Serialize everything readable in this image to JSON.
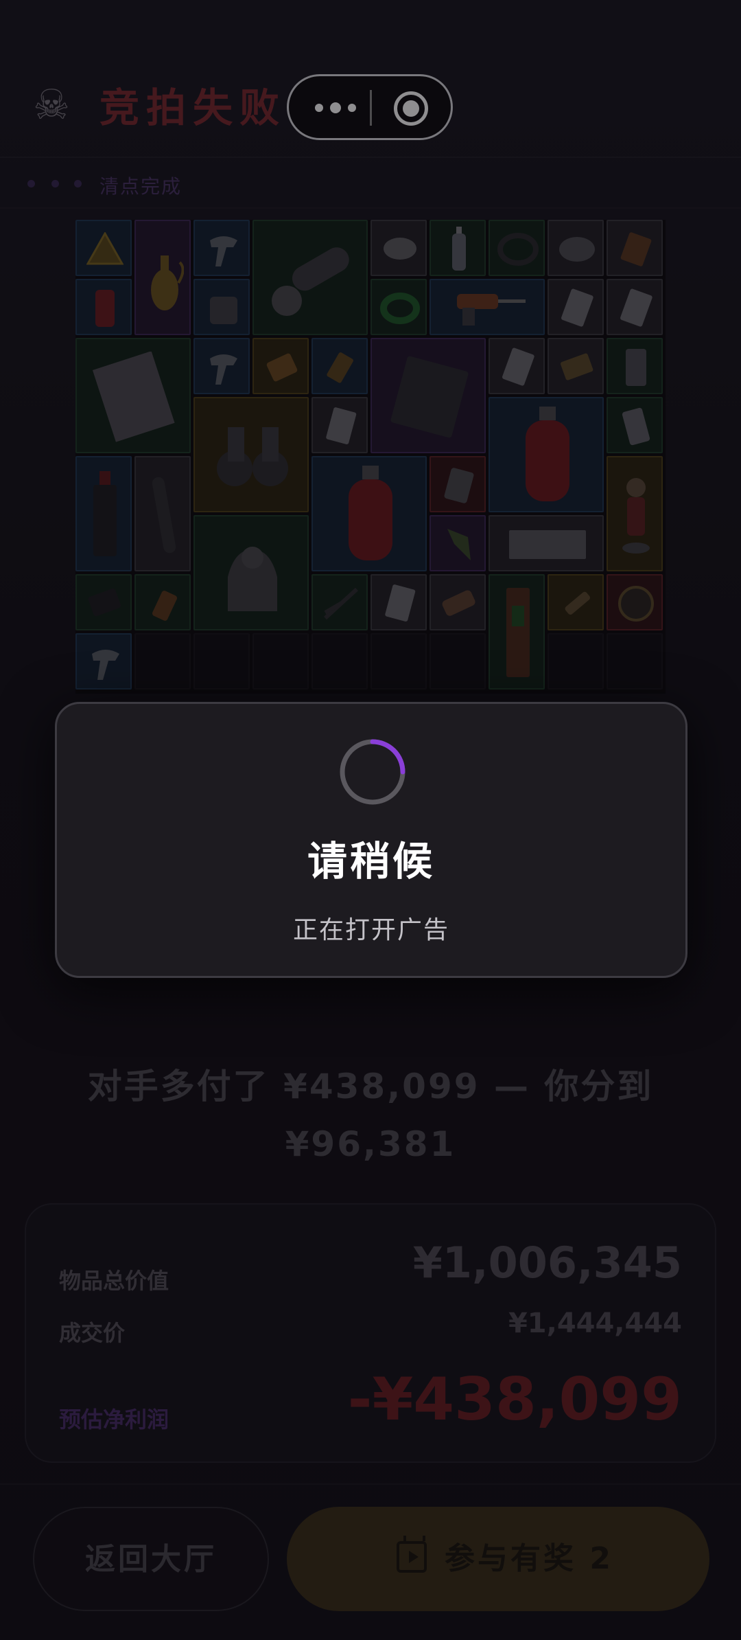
{
  "header": {
    "title": "竞拍失败",
    "skull_icon": "skull-icon",
    "menu_icon": "more-dots-icon",
    "close_icon": "target-circle-icon"
  },
  "status": {
    "text": "清点完成"
  },
  "inventory": {
    "items": [
      "warning-sign",
      "teapot",
      "thermometer-gun",
      "angle-grinder",
      "mouse",
      "water-bottle",
      "cable-coil",
      "tape-roll",
      "matchbox",
      "soda-can",
      "power-adapter",
      "green-cable",
      "power-drill",
      "playing-card",
      "playing-card",
      "magazine",
      "thermometer-gun",
      "battery-pack",
      "snack-bar",
      "motherboard",
      "playing-card",
      "playing-card",
      "cpu-cooler",
      "binoculars",
      "id-card",
      "gas-cylinder",
      "battery",
      "bottle",
      "test-tube",
      "gas-cylinder",
      "circuit-board",
      "gas-cylinder",
      "figurine",
      "sphinx-statue",
      "arrow-head",
      "newspaper",
      "wallet",
      "medicine-bottle",
      "pliers",
      "playing-card",
      "bandage",
      "fire-extinguisher-panel",
      "spark-plug",
      "tin-can",
      "thermometer-gun"
    ]
  },
  "modal": {
    "title": "请稍候",
    "subtitle": "正在打开广告"
  },
  "message": {
    "line1": "对手多付了 ¥438,099 — 你分到",
    "line2": "¥96,381"
  },
  "summary": {
    "total_label": "物品总价值",
    "total_value": "¥1,006,345",
    "deal_label": "成交价",
    "deal_value": "¥1,444,444",
    "profit_label": "预估净利润",
    "profit_value": "-¥438,099"
  },
  "buttons": {
    "back_label": "返回大厅",
    "prize_label": "参与有奖 2",
    "prize_icon": "video-play-icon"
  },
  "colors": {
    "accent_purple": "#8a3fd8",
    "loss_red": "#c0303a",
    "gold_button": "#e0b23c"
  }
}
